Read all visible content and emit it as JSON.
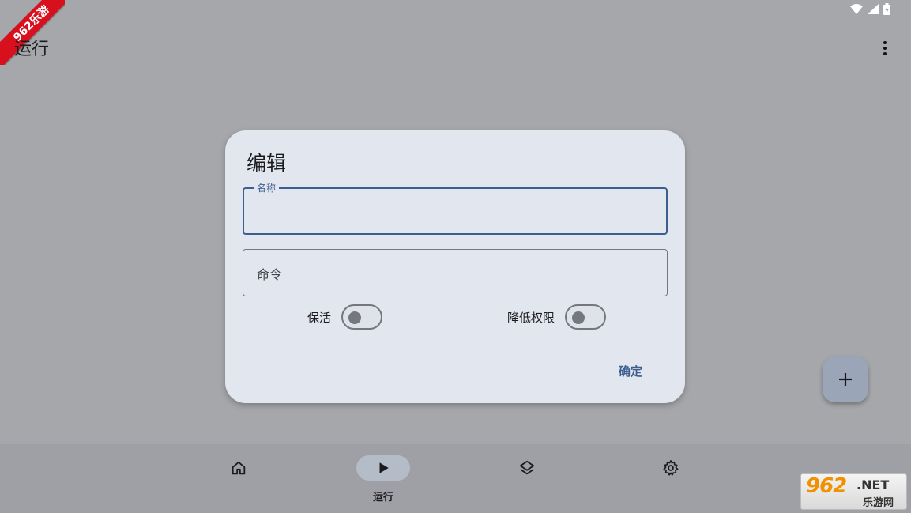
{
  "app_bar": {
    "title": "运行"
  },
  "watermark": {
    "corner_text": "962乐游",
    "br_number": "962",
    "br_net": ".NET",
    "br_sub": "乐游网"
  },
  "dialog": {
    "title": "编辑",
    "name_field": {
      "label": "名称",
      "value": ""
    },
    "command_field": {
      "placeholder": "命令",
      "value": ""
    },
    "switches": [
      {
        "label": "保活",
        "checked": false
      },
      {
        "label": "降低权限",
        "checked": false
      }
    ],
    "confirm_label": "确定"
  },
  "bottom_nav": {
    "items": [
      {
        "icon": "home-icon",
        "label": ""
      },
      {
        "icon": "play-icon",
        "label": "运行",
        "active": true
      },
      {
        "icon": "layers-icon",
        "label": ""
      },
      {
        "icon": "gear-icon",
        "label": ""
      }
    ]
  },
  "colors": {
    "accent": "#3d5f8f",
    "scrim": "#a6a7ab",
    "dialog_bg": "#e2e6ee"
  }
}
